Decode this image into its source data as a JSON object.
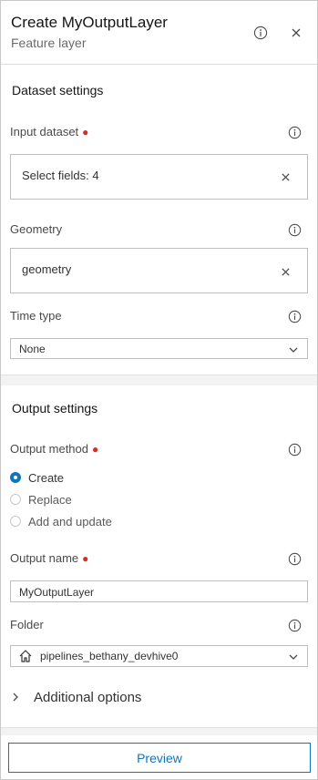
{
  "header": {
    "title": "Create MyOutputLayer",
    "subtitle": "Feature layer"
  },
  "dataset_settings": {
    "title": "Dataset settings",
    "input_dataset": {
      "label": "Input dataset",
      "value": "Select fields: 4"
    },
    "geometry": {
      "label": "Geometry",
      "value": "geometry"
    },
    "time_type": {
      "label": "Time type",
      "selected": "None"
    }
  },
  "output_settings": {
    "title": "Output settings",
    "output_method": {
      "label": "Output method",
      "options": [
        "Create",
        "Replace",
        "Add and update"
      ],
      "selected": "Create"
    },
    "output_name": {
      "label": "Output name",
      "value": "MyOutputLayer"
    },
    "folder": {
      "label": "Folder",
      "selected": "pipelines_bethany_devhive0"
    }
  },
  "additional_options": {
    "label": "Additional options"
  },
  "footer": {
    "preview_label": "Preview"
  },
  "colors": {
    "accent": "#0f75bc",
    "required": "#d83020",
    "divider": "#f3f3f3"
  }
}
